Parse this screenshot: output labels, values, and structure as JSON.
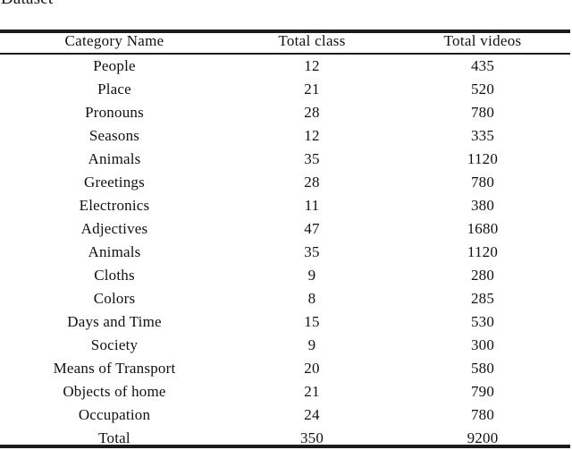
{
  "caption": {
    "text": "Dataset"
  },
  "table": {
    "columns": [
      {
        "key": "category",
        "label": "Category Name",
        "align": "center"
      },
      {
        "key": "total_class",
        "label": "Total class",
        "align": "center"
      },
      {
        "key": "total_videos",
        "label": "Total videos",
        "align": "center"
      }
    ],
    "rows": [
      {
        "category": "People",
        "total_class": "12",
        "total_videos": "435"
      },
      {
        "category": "Place",
        "total_class": "21",
        "total_videos": "520"
      },
      {
        "category": "Pronouns",
        "total_class": "28",
        "total_videos": "780"
      },
      {
        "category": "Seasons",
        "total_class": "12",
        "total_videos": "335"
      },
      {
        "category": "Animals",
        "total_class": "35",
        "total_videos": "1120"
      },
      {
        "category": "Greetings",
        "total_class": "28",
        "total_videos": "780"
      },
      {
        "category": "Electronics",
        "total_class": "11",
        "total_videos": "380"
      },
      {
        "category": "Adjectives",
        "total_class": "47",
        "total_videos": "1680"
      },
      {
        "category": "Animals",
        "total_class": "35",
        "total_videos": "1120"
      },
      {
        "category": "Cloths",
        "total_class": "9",
        "total_videos": "280"
      },
      {
        "category": "Colors",
        "total_class": "8",
        "total_videos": "285"
      },
      {
        "category": "Days and Time",
        "total_class": "15",
        "total_videos": "530"
      },
      {
        "category": "Society",
        "total_class": "9",
        "total_videos": "300"
      },
      {
        "category": "Means of Transport",
        "total_class": "20",
        "total_videos": "580"
      },
      {
        "category": "Objects of home",
        "total_class": "21",
        "total_videos": "790"
      },
      {
        "category": "Occupation",
        "total_class": "24",
        "total_videos": "780"
      },
      {
        "category": "Total",
        "total_class": "350",
        "total_videos": "9200"
      }
    ],
    "total_row_index": 16
  },
  "chart_data": {
    "type": "table",
    "title": "Dataset",
    "columns": [
      "Category Name",
      "Total class",
      "Total videos"
    ],
    "categories": [
      "People",
      "Place",
      "Pronouns",
      "Seasons",
      "Animals",
      "Greetings",
      "Electronics",
      "Adjectives",
      "Animals",
      "Cloths",
      "Colors",
      "Days and Time",
      "Society",
      "Means of Transport",
      "Objects of home",
      "Occupation",
      "Total"
    ],
    "series": [
      {
        "name": "Total class",
        "values": [
          12,
          21,
          28,
          12,
          35,
          28,
          11,
          47,
          35,
          9,
          8,
          15,
          9,
          20,
          21,
          24,
          350
        ]
      },
      {
        "name": "Total videos",
        "values": [
          435,
          520,
          780,
          335,
          1120,
          780,
          380,
          1680,
          1120,
          280,
          285,
          530,
          300,
          580,
          790,
          780,
          9200
        ]
      }
    ],
    "summary_row": {
      "label": "Total",
      "total_class": 350,
      "total_videos": 9200
    },
    "grid": false,
    "legend": "none"
  },
  "style": {
    "background": "#ffffff",
    "text_color": "#111111",
    "rule_color": "#1b1b1b"
  }
}
